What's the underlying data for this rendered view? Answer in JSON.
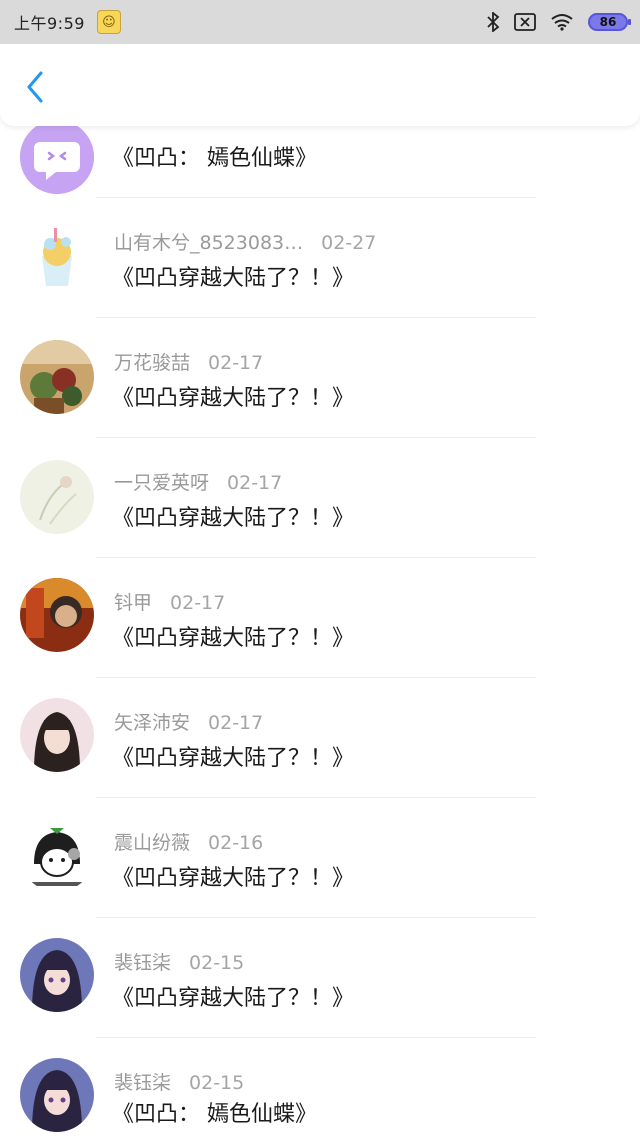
{
  "status_bar": {
    "time": "上午9:59",
    "battery": "86"
  },
  "items": [
    {
      "name": "",
      "date": "",
      "title": "《凹凸： 嫣色仙蝶》"
    },
    {
      "name": "山有木兮_8523083…",
      "date": "02-27",
      "title": "《凹凸穿越大陆了？！》"
    },
    {
      "name": "万花骏喆",
      "date": "02-17",
      "title": "《凹凸穿越大陆了？！》"
    },
    {
      "name": "一只爱英呀",
      "date": "02-17",
      "title": "《凹凸穿越大陆了？！》"
    },
    {
      "name": "钭甲",
      "date": "02-17",
      "title": "《凹凸穿越大陆了？！》"
    },
    {
      "name": "矢泽沛安",
      "date": "02-17",
      "title": "《凹凸穿越大陆了？！》"
    },
    {
      "name": "震山纷薇",
      "date": "02-16",
      "title": "《凹凸穿越大陆了？！》"
    },
    {
      "name": "裴钰柒",
      "date": "02-15",
      "title": "《凹凸穿越大陆了？！》"
    },
    {
      "name": "裴钰柒",
      "date": "02-15",
      "title": "《凹凸： 嫣色仙蝶》"
    }
  ]
}
